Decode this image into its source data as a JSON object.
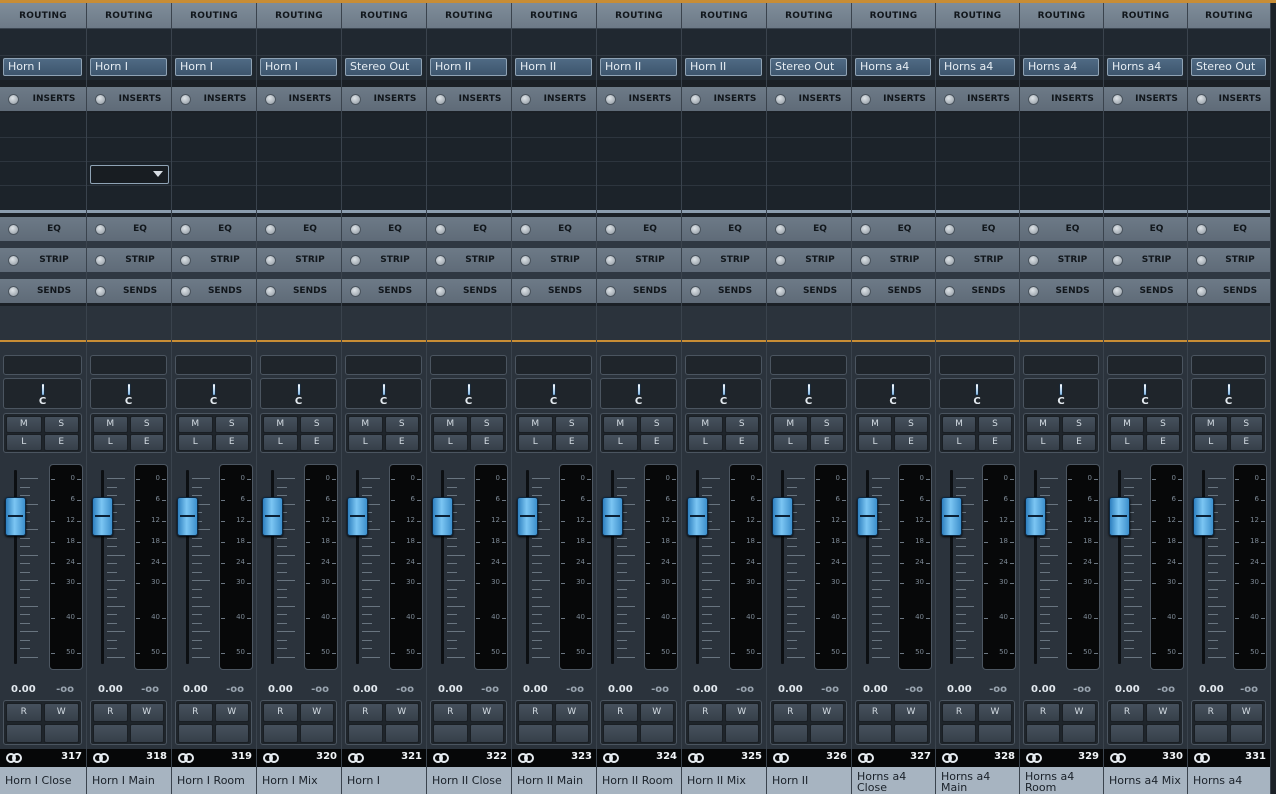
{
  "section_labels": {
    "routing": "ROUTING",
    "inserts": "INSERTS",
    "eq": "EQ",
    "strip": "STRIP",
    "sends": "SENDS"
  },
  "controls": {
    "mute": "M",
    "solo": "S",
    "listen": "L",
    "edit": "E",
    "read": "R",
    "write": "W",
    "pan_value": "C",
    "volume": "0.00",
    "peak": "-oo"
  },
  "meter_scale": [
    "0",
    "6",
    "12",
    "18",
    "24",
    "30",
    "40",
    "50"
  ],
  "colors": {
    "accent_orange": "#c88d35",
    "fader_cap": "#5aaee6",
    "name_bar": "#a7b4c1"
  },
  "channels": [
    {
      "number": "317",
      "name": "Horn I Close",
      "output": "Horn I"
    },
    {
      "number": "318",
      "name": "Horn I Main",
      "output": "Horn I"
    },
    {
      "number": "319",
      "name": "Horn I Room",
      "output": "Horn I"
    },
    {
      "number": "320",
      "name": "Horn I Mix",
      "output": "Horn I"
    },
    {
      "number": "321",
      "name": "Horn I",
      "output": "Stereo Out"
    },
    {
      "number": "322",
      "name": "Horn II Close",
      "output": "Horn II"
    },
    {
      "number": "323",
      "name": "Horn II Main",
      "output": "Horn II"
    },
    {
      "number": "324",
      "name": "Horn II Room",
      "output": "Horn II"
    },
    {
      "number": "325",
      "name": "Horn II Mix",
      "output": "Horn II"
    },
    {
      "number": "326",
      "name": "Horn II",
      "output": "Stereo Out"
    },
    {
      "number": "327",
      "name": "Horns a4 Close",
      "output": "Horns a4"
    },
    {
      "number": "328",
      "name": "Horns a4 Main",
      "output": "Horns a4"
    },
    {
      "number": "329",
      "name": "Horns a4 Room",
      "output": "Horns a4"
    },
    {
      "number": "330",
      "name": "Horns a4 Mix",
      "output": "Horns a4"
    },
    {
      "number": "331",
      "name": "Horns a4",
      "output": "Stereo Out"
    }
  ]
}
